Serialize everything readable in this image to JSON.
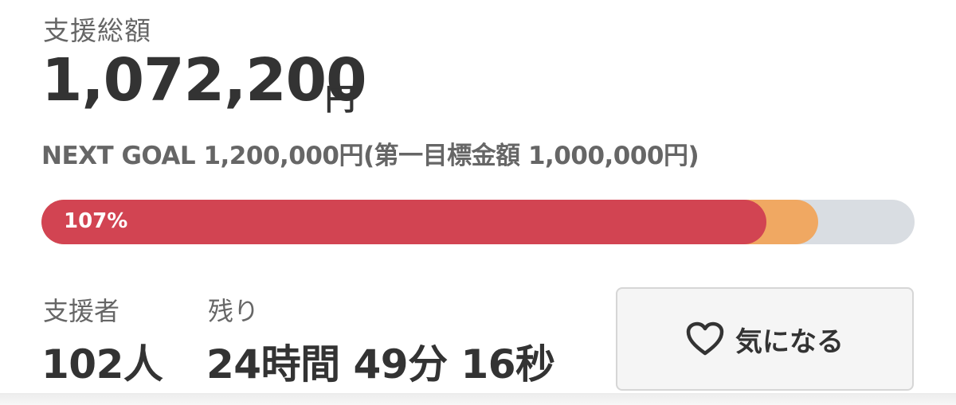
{
  "summary": {
    "total_label": "支援総額",
    "total_amount": "1,072,200",
    "total_unit": "円",
    "next_goal": "NEXT GOAL 1,200,000円(第一目標金額 1,000,000円)"
  },
  "progress": {
    "percent_label": "107%",
    "funded_fraction": 0.83,
    "next_goal_fraction": 0.89,
    "colors": {
      "fill": "#d24452",
      "next_goal": "#f0a862",
      "track": "#d9dde2"
    }
  },
  "stats": {
    "supporters_label": "支援者",
    "supporters_value": "102人",
    "remaining_label": "残り",
    "remaining_value": "24時間 49分 16秒"
  },
  "favorite_button": {
    "icon": "heart-icon",
    "label": "気になる"
  }
}
